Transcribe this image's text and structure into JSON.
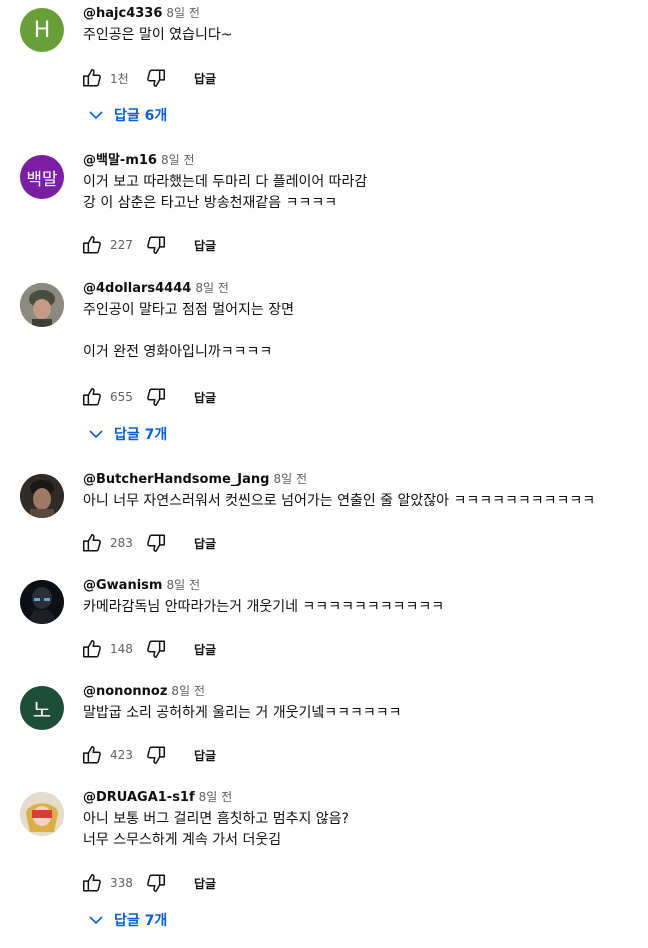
{
  "comments": [
    {
      "author": "@hajc4336",
      "time": "8일 전",
      "avatar_letter": "H",
      "text": "주인공은 말이 였습니다~",
      "likes": "1천",
      "reply_label": "답글",
      "replies_label": "답글 6개"
    },
    {
      "author": "@백말-m16",
      "time": "8일 전",
      "avatar_letter": "백말",
      "text": "이거 보고 따라했는데 두마리 다 플레이어 따라감\n강 이 삼춘은 타고난 방송천재같음 ㅋㅋㅋㅋ",
      "likes": "227",
      "reply_label": "답글"
    },
    {
      "author": "@4dollars4444",
      "time": "8일 전",
      "text": "주인공이 말타고 점점 멀어지는 장면\n\n이거 완전 영화아입니까ㅋㅋㅋㅋ",
      "likes": "655",
      "reply_label": "답글",
      "replies_label": "답글 7개"
    },
    {
      "author": "@ButcherHandsome_Jang",
      "time": "8일 전",
      "text": "아니 너무 자연스러워서 컷씬으로 넘어가는 연출인 줄 알았잖아 ㅋㅋㅋㅋㅋㅋㅋㅋㅋㅋㅋ",
      "likes": "283",
      "reply_label": "답글"
    },
    {
      "author": "@Gwanism",
      "time": "8일 전",
      "text": "카메라감독님 안따라가는거 개웃기네 ㅋㅋㅋㅋㅋㅋㅋㅋㅋㅋㅋ",
      "likes": "148",
      "reply_label": "답글"
    },
    {
      "author": "@nononnoz",
      "time": "8일 전",
      "avatar_letter": "노",
      "text": "말밥굽 소리 공허하게 울리는 거 개웃기넼ㅋㅋㅋㅋㅋㅋ",
      "likes": "423",
      "reply_label": "답글"
    },
    {
      "author": "@DRUAGA1-s1f",
      "time": "8일 전",
      "text": "아니 보통 버그 걸리면 흠칫하고 멈추지 않음?\n너무 스무스하게 계속 가서 더웃김",
      "likes": "338",
      "reply_label": "답글",
      "replies_label": "답글 7개"
    }
  ],
  "icons": {
    "like": "thumb-up-icon",
    "dislike": "thumb-down-icon",
    "expand": "chevron-down-icon"
  },
  "colors": {
    "link": "#065fd4",
    "meta": "#606060"
  }
}
